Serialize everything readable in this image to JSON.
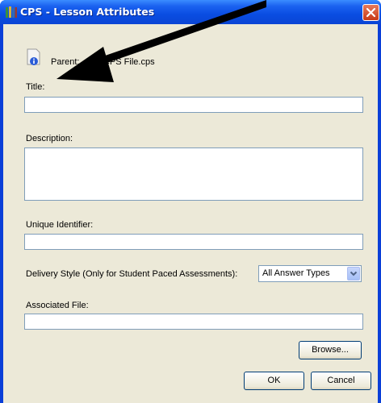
{
  "window": {
    "title": "CPS - Lesson Attributes"
  },
  "parent": {
    "label": "Parent:",
    "file": "CPS File.cps"
  },
  "form": {
    "title_label": "Title:",
    "title_value": "",
    "description_label": "Description:",
    "description_value": "",
    "identifier_label": "Unique Identifier:",
    "identifier_value": "",
    "delivery_label": "Delivery Style (Only for Student Paced Assessments):",
    "delivery_selected": "All Answer Types",
    "associated_label": "Associated File:",
    "associated_value": ""
  },
  "buttons": {
    "browse": "Browse...",
    "ok": "OK",
    "cancel": "Cancel"
  },
  "icons": {
    "app": "books-icon",
    "info": "info-file-icon",
    "close": "close-icon",
    "dropdown": "chevron-down-icon",
    "annotation": "arrow-annotation"
  },
  "colors": {
    "titlebar": "#0a4de2",
    "dialog_bg": "#ece9d8",
    "close": "#c83a17",
    "field_border": "#7f9db9"
  }
}
